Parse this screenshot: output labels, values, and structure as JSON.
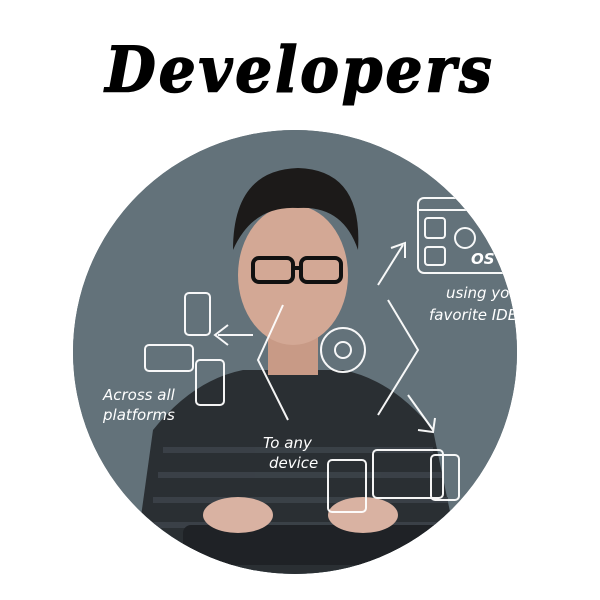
{
  "title": "Developers",
  "photo": {
    "annotations": {
      "platforms_line1": "Across all",
      "platforms_line2": "platforms",
      "device_line1": "To any",
      "device_line2": "device",
      "ide_line1": "using your",
      "ide_line2": "favorite IDE"
    },
    "icon_labels": {
      "os_badge": "OS"
    }
  },
  "colors": {
    "title": "#000000",
    "background": "#ffffff",
    "photo_backdrop": "#5d6c74",
    "sketch_lines": "#ffffff"
  }
}
